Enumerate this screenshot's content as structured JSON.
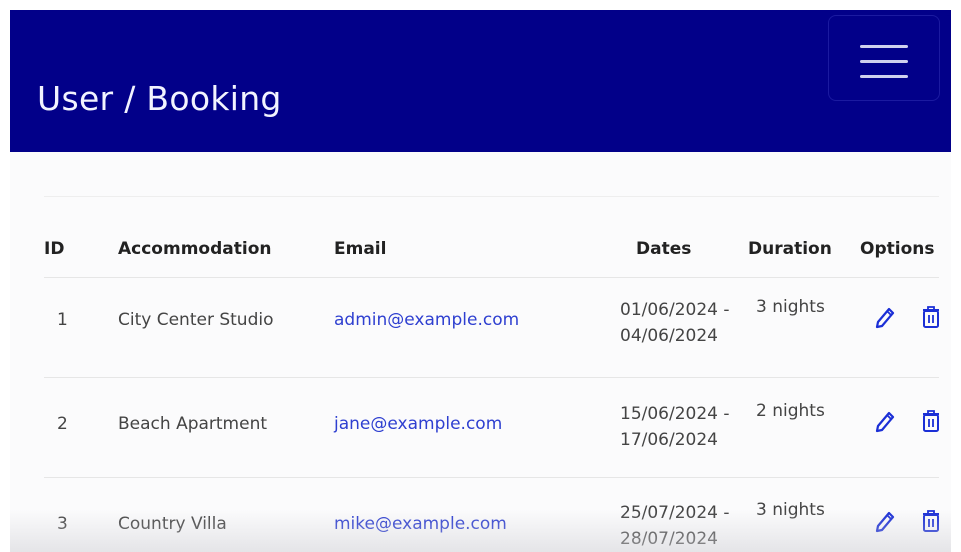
{
  "header": {
    "title": "User / Booking"
  },
  "menu": {
    "icon": "hamburger-menu-icon"
  },
  "table": {
    "headers": {
      "id": "ID",
      "accommodation": "Accommodation",
      "email": "Email",
      "dates": "Dates",
      "duration": "Duration",
      "options": "Options"
    },
    "rows": [
      {
        "id": "1",
        "accommodation": "City Center Studio",
        "email": "admin@example.com",
        "start": "01/06/2024 -",
        "end": "04/06/2024",
        "duration": "3 nights"
      },
      {
        "id": "2",
        "accommodation": "Beach Apartment",
        "email": "jane@example.com",
        "start": "15/06/2024 -",
        "end": "17/06/2024",
        "duration": "2 nights"
      },
      {
        "id": "3",
        "accommodation": "Country Villa",
        "email": "mike@example.com",
        "start": "25/07/2024 -",
        "end": "28/07/2024",
        "duration": "3 nights"
      }
    ],
    "icons": {
      "edit": "pencil-icon",
      "delete": "trash-icon"
    }
  },
  "colors": {
    "navbar": "#020089",
    "link": "#2e3fd0",
    "icon": "#1b2fd6"
  }
}
